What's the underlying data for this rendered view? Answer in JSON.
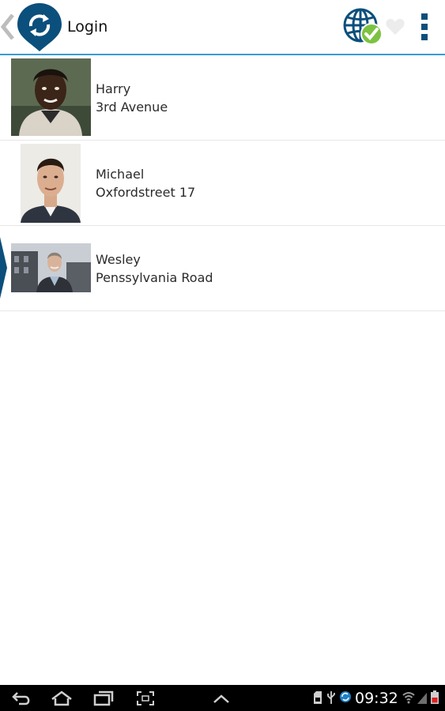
{
  "action_bar": {
    "title": "Login",
    "icons": {
      "back": "chevron-left-icon",
      "logo": "sync-pin-logo-icon",
      "globe": "globe-check-icon",
      "favorite": "heart-icon",
      "overflow": "overflow-menu-icon"
    }
  },
  "contacts": [
    {
      "name": "Harry",
      "address": "3rd Avenue"
    },
    {
      "name": "Michael",
      "address": "Oxfordstreet 17"
    },
    {
      "name": "Wesley",
      "address": "Penssylvania Road"
    }
  ],
  "system_bar": {
    "time": "09:32",
    "icons": [
      "back-icon",
      "home-icon",
      "recent-apps-icon",
      "screenshot-icon",
      "up-arrow-icon",
      "sd-card-icon",
      "usb-icon",
      "app-notification-icon",
      "wifi-icon",
      "signal-icon",
      "battery-icon"
    ]
  },
  "colors": {
    "accent": "#3a9bd5",
    "brand_dark": "#0b4f7c",
    "check_green": "#7cc242"
  }
}
